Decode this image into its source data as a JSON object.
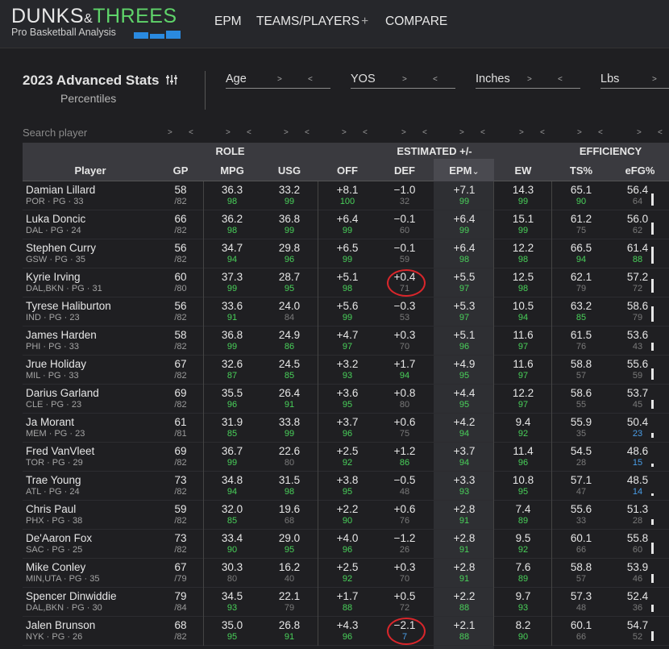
{
  "brand": {
    "logo_word1": "DUNKS",
    "logo_amp": "&",
    "logo_word2": "THREES",
    "tagline": "Pro Basketball Analysis"
  },
  "nav": [
    {
      "label": "EPM"
    },
    {
      "label": "TEAMS/PLAYERS"
    },
    {
      "label": "COMPARE"
    }
  ],
  "nav_plus": "+",
  "page": {
    "title": "2023 Advanced Stats",
    "subtitle": "Percentiles"
  },
  "filters": [
    {
      "label": "Age"
    },
    {
      "label": "YOS"
    },
    {
      "label": "Inches"
    },
    {
      "label": "Lbs"
    }
  ],
  "arrows": {
    "right": ">",
    "left": "<"
  },
  "search": {
    "placeholder": "Search player"
  },
  "groups": {
    "role": "ROLE",
    "estimated": "ESTIMATED +/-",
    "efficiency": "EFFICIENCY"
  },
  "columns": {
    "player": "Player",
    "gp": "GP",
    "mpg": "MPG",
    "usg": "USG",
    "off": "OFF",
    "def": "DEF",
    "epm": "EPM",
    "ew": "EW",
    "ts": "TS%",
    "efg": "eFG%"
  },
  "sort_indicator": "⌄",
  "colors": {
    "green": "#49d15a",
    "gray": "#7a7a7a",
    "blue": "#4a9ee8",
    "highlight_circle": "#d9262b",
    "logo_green": "#5fd46a",
    "logo_blue": "#2a8ae0"
  },
  "rows": [
    {
      "name": "Damian Lillard",
      "meta": "POR · PG · 33",
      "gp": "58",
      "gp_total": "/82",
      "mpg": "36.3",
      "mpg_p": "98",
      "usg": "33.2",
      "usg_p": "99",
      "off": "+8.1",
      "off_p": "100",
      "def": "−1.0",
      "def_p": "32",
      "epm": "+7.1",
      "epm_p": "99",
      "ew": "14.3",
      "ew_p": "99",
      "ts": "65.1",
      "ts_p": "90",
      "efg": "56.4",
      "efg_p": "64"
    },
    {
      "name": "Luka Doncic",
      "meta": "DAL · PG · 24",
      "gp": "66",
      "gp_total": "/82",
      "mpg": "36.2",
      "mpg_p": "98",
      "usg": "36.8",
      "usg_p": "99",
      "off": "+6.4",
      "off_p": "99",
      "def": "−0.1",
      "def_p": "60",
      "epm": "+6.4",
      "epm_p": "99",
      "ew": "15.1",
      "ew_p": "99",
      "ts": "61.2",
      "ts_p": "75",
      "efg": "56.0",
      "efg_p": "62"
    },
    {
      "name": "Stephen Curry",
      "meta": "GSW · PG · 35",
      "gp": "56",
      "gp_total": "/82",
      "mpg": "34.7",
      "mpg_p": "94",
      "usg": "29.8",
      "usg_p": "96",
      "off": "+6.5",
      "off_p": "99",
      "def": "−0.1",
      "def_p": "59",
      "epm": "+6.4",
      "epm_p": "98",
      "ew": "12.2",
      "ew_p": "98",
      "ts": "66.5",
      "ts_p": "94",
      "efg": "61.4",
      "efg_p": "88"
    },
    {
      "name": "Kyrie Irving",
      "meta": "DAL,BKN · PG · 31",
      "gp": "60",
      "gp_total": "/80",
      "mpg": "37.3",
      "mpg_p": "99",
      "usg": "28.7",
      "usg_p": "95",
      "off": "+5.1",
      "off_p": "98",
      "def": "+0.4",
      "def_p": "71",
      "epm": "+5.5",
      "epm_p": "97",
      "ew": "12.5",
      "ew_p": "98",
      "ts": "62.1",
      "ts_p": "79",
      "efg": "57.2",
      "efg_p": "72"
    },
    {
      "name": "Tyrese Haliburton",
      "meta": "IND · PG · 23",
      "gp": "56",
      "gp_total": "/82",
      "mpg": "33.6",
      "mpg_p": "91",
      "usg": "24.0",
      "usg_p": "84",
      "off": "+5.6",
      "off_p": "99",
      "def": "−0.3",
      "def_p": "53",
      "epm": "+5.3",
      "epm_p": "97",
      "ew": "10.5",
      "ew_p": "94",
      "ts": "63.2",
      "ts_p": "85",
      "efg": "58.6",
      "efg_p": "79"
    },
    {
      "name": "James Harden",
      "meta": "PHI · PG · 33",
      "gp": "58",
      "gp_total": "/82",
      "mpg": "36.8",
      "mpg_p": "99",
      "usg": "24.9",
      "usg_p": "86",
      "off": "+4.7",
      "off_p": "97",
      "def": "+0.3",
      "def_p": "70",
      "epm": "+5.1",
      "epm_p": "96",
      "ew": "11.6",
      "ew_p": "97",
      "ts": "61.5",
      "ts_p": "76",
      "efg": "53.6",
      "efg_p": "43"
    },
    {
      "name": "Jrue Holiday",
      "meta": "MIL · PG · 33",
      "gp": "67",
      "gp_total": "/82",
      "mpg": "32.6",
      "mpg_p": "87",
      "usg": "24.5",
      "usg_p": "85",
      "off": "+3.2",
      "off_p": "93",
      "def": "+1.7",
      "def_p": "94",
      "epm": "+4.9",
      "epm_p": "95",
      "ew": "11.6",
      "ew_p": "97",
      "ts": "58.8",
      "ts_p": "57",
      "efg": "55.6",
      "efg_p": "59"
    },
    {
      "name": "Darius Garland",
      "meta": "CLE · PG · 23",
      "gp": "69",
      "gp_total": "/82",
      "mpg": "35.5",
      "mpg_p": "96",
      "usg": "26.4",
      "usg_p": "91",
      "off": "+3.6",
      "off_p": "95",
      "def": "+0.8",
      "def_p": "80",
      "epm": "+4.4",
      "epm_p": "95",
      "ew": "12.2",
      "ew_p": "97",
      "ts": "58.6",
      "ts_p": "55",
      "efg": "53.7",
      "efg_p": "45"
    },
    {
      "name": "Ja Morant",
      "meta": "MEM · PG · 23",
      "gp": "61",
      "gp_total": "/81",
      "mpg": "31.9",
      "mpg_p": "85",
      "usg": "33.8",
      "usg_p": "99",
      "off": "+3.7",
      "off_p": "96",
      "def": "+0.6",
      "def_p": "75",
      "epm": "+4.2",
      "epm_p": "94",
      "ew": "9.4",
      "ew_p": "92",
      "ts": "55.9",
      "ts_p": "35",
      "efg": "50.4",
      "efg_p": "23"
    },
    {
      "name": "Fred VanVleet",
      "meta": "TOR · PG · 29",
      "gp": "69",
      "gp_total": "/82",
      "mpg": "36.7",
      "mpg_p": "99",
      "usg": "22.6",
      "usg_p": "80",
      "off": "+2.5",
      "off_p": "92",
      "def": "+1.2",
      "def_p": "86",
      "epm": "+3.7",
      "epm_p": "94",
      "ew": "11.4",
      "ew_p": "96",
      "ts": "54.5",
      "ts_p": "28",
      "efg": "48.6",
      "efg_p": "15"
    },
    {
      "name": "Trae Young",
      "meta": "ATL · PG · 24",
      "gp": "73",
      "gp_total": "/82",
      "mpg": "34.8",
      "mpg_p": "94",
      "usg": "31.5",
      "usg_p": "98",
      "off": "+3.8",
      "off_p": "95",
      "def": "−0.5",
      "def_p": "48",
      "epm": "+3.3",
      "epm_p": "93",
      "ew": "10.8",
      "ew_p": "95",
      "ts": "57.1",
      "ts_p": "47",
      "efg": "48.5",
      "efg_p": "14"
    },
    {
      "name": "Chris Paul",
      "meta": "PHX · PG · 38",
      "gp": "59",
      "gp_total": "/82",
      "mpg": "32.0",
      "mpg_p": "85",
      "usg": "19.6",
      "usg_p": "68",
      "off": "+2.2",
      "off_p": "90",
      "def": "+0.6",
      "def_p": "76",
      "epm": "+2.8",
      "epm_p": "91",
      "ew": "7.4",
      "ew_p": "89",
      "ts": "55.6",
      "ts_p": "33",
      "efg": "51.3",
      "efg_p": "28"
    },
    {
      "name": "De'Aaron Fox",
      "meta": "SAC · PG · 25",
      "gp": "73",
      "gp_total": "/82",
      "mpg": "33.4",
      "mpg_p": "90",
      "usg": "29.0",
      "usg_p": "95",
      "off": "+4.0",
      "off_p": "96",
      "def": "−1.2",
      "def_p": "26",
      "epm": "+2.8",
      "epm_p": "91",
      "ew": "9.5",
      "ew_p": "92",
      "ts": "60.1",
      "ts_p": "66",
      "efg": "55.8",
      "efg_p": "60"
    },
    {
      "name": "Mike Conley",
      "meta": "MIN,UTA · PG · 35",
      "gp": "67",
      "gp_total": "/79",
      "mpg": "30.3",
      "mpg_p": "80",
      "usg": "16.2",
      "usg_p": "40",
      "off": "+2.5",
      "off_p": "92",
      "def": "+0.3",
      "def_p": "70",
      "epm": "+2.8",
      "epm_p": "91",
      "ew": "7.6",
      "ew_p": "89",
      "ts": "58.8",
      "ts_p": "57",
      "efg": "53.9",
      "efg_p": "46"
    },
    {
      "name": "Spencer Dinwiddie",
      "meta": "DAL,BKN · PG · 30",
      "gp": "79",
      "gp_total": "/84",
      "mpg": "34.5",
      "mpg_p": "93",
      "usg": "22.1",
      "usg_p": "79",
      "off": "+1.7",
      "off_p": "88",
      "def": "+0.5",
      "def_p": "72",
      "epm": "+2.2",
      "epm_p": "88",
      "ew": "9.7",
      "ew_p": "93",
      "ts": "57.3",
      "ts_p": "48",
      "efg": "52.4",
      "efg_p": "36"
    },
    {
      "name": "Jalen Brunson",
      "meta": "NYK · PG · 26",
      "gp": "68",
      "gp_total": "/82",
      "mpg": "35.0",
      "mpg_p": "95",
      "usg": "26.8",
      "usg_p": "91",
      "off": "+4.3",
      "off_p": "96",
      "def": "−2.1",
      "def_p": "7",
      "epm": "+2.1",
      "epm_p": "88",
      "ew": "8.2",
      "ew_p": "90",
      "ts": "60.1",
      "ts_p": "66",
      "efg": "54.7",
      "efg_p": "52"
    }
  ],
  "circled_cells": [
    {
      "row": 3,
      "col": "def"
    },
    {
      "row": 15,
      "col": "def"
    }
  ]
}
